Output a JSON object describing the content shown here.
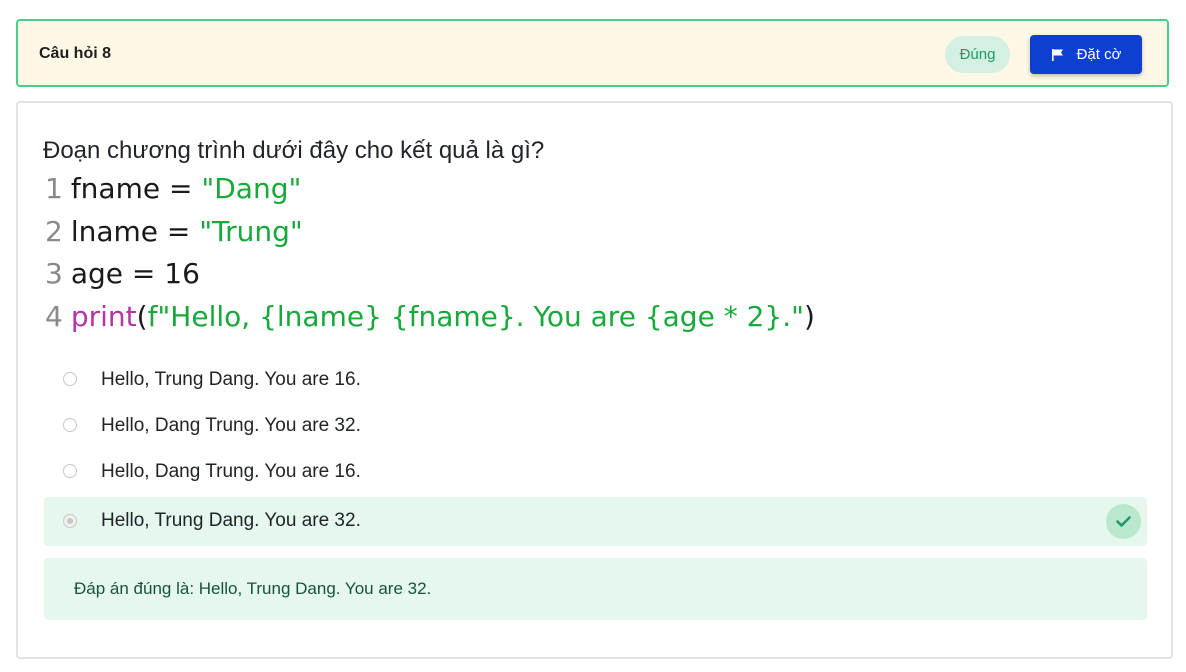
{
  "header": {
    "title": "Câu hỏi 8",
    "status": "Đúng",
    "flag_label": "Đặt cờ"
  },
  "question": {
    "text": "Đoạn chương trình dưới đây cho kết quả là gì?",
    "code_lines": [
      {
        "num": "1",
        "parts": [
          {
            "text": "fname = ",
            "cls": ""
          },
          {
            "text": "\"Dang\"",
            "cls": "str"
          }
        ]
      },
      {
        "num": "2",
        "parts": [
          {
            "text": "lname = ",
            "cls": ""
          },
          {
            "text": "\"Trung\"",
            "cls": "str"
          }
        ]
      },
      {
        "num": "3",
        "parts": [
          {
            "text": "age = 16",
            "cls": ""
          }
        ]
      },
      {
        "num": "4",
        "parts": [
          {
            "text": "print",
            "cls": "kw"
          },
          {
            "text": "(",
            "cls": ""
          },
          {
            "text": "f\"Hello, {lname} {fname}. You are {age * 2}.\"",
            "cls": "str"
          },
          {
            "text": ")",
            "cls": ""
          }
        ]
      }
    ]
  },
  "options": [
    {
      "label": "Hello, Trung Dang. You are 16.",
      "selected": false
    },
    {
      "label": "Hello, Dang Trung. You are 32.",
      "selected": false
    },
    {
      "label": "Hello, Dang Trung. You are 16.",
      "selected": false
    },
    {
      "label": "Hello, Trung Dang. You are 32.",
      "selected": true
    }
  ],
  "feedback": {
    "text": "Đáp án đúng là: Hello, Trung Dang. You are 32."
  },
  "colors": {
    "accent": "#0d3fd0",
    "correct_border": "#4cce8b",
    "correct_bg": "#e6f7ee",
    "header_bg": "#fff8e6"
  },
  "icons": {
    "flag": "flag-icon",
    "check": "check-icon"
  }
}
